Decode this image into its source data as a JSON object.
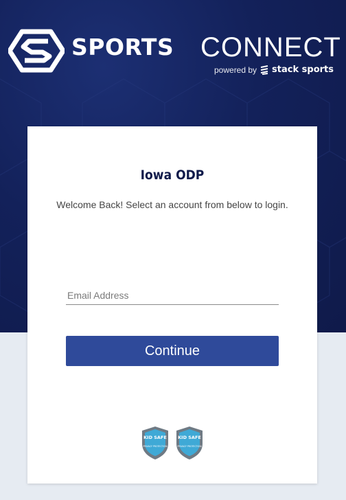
{
  "brand": {
    "bold": "SPORTS",
    "light": "CONNECT",
    "powered_by": "powered by",
    "stack": "stack sports"
  },
  "login": {
    "org_name": "Iowa ODP",
    "welcome": "Welcome Back! Select an account from below to login.",
    "email_placeholder": "Email Address",
    "email_value": "",
    "continue_label": "Continue"
  },
  "badges": [
    {
      "title": "KID SAFE",
      "subtitle": "PRIVACY PROTECTION"
    },
    {
      "title": "KID SAFE",
      "subtitle": "PRIVACY PROTECTION"
    }
  ],
  "colors": {
    "hero": "#13215a",
    "button": "#2f4a9a",
    "page_bg": "#e6ebf2",
    "badge": "#3fa9d6"
  },
  "icons": {
    "brand_mark": "sports-connect-hex-logo-icon",
    "stack_mark": "stack-sports-logo-icon",
    "badge": "kid-safe-shield-icon"
  }
}
